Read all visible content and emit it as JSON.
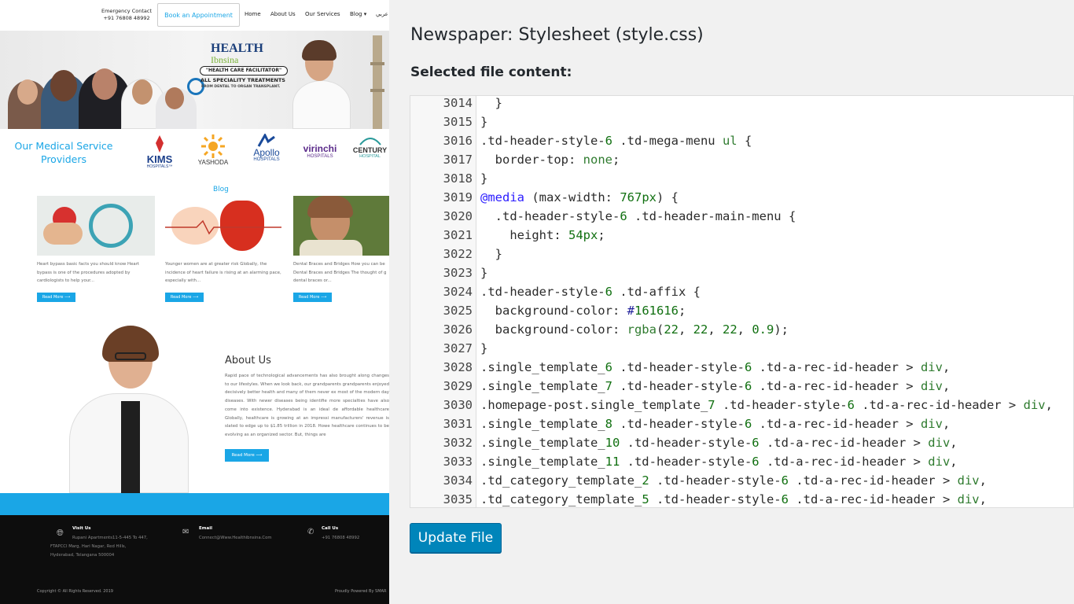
{
  "site": {
    "emergency_label": "Emergency Contact",
    "emergency_phone": "+91 76808 48992",
    "book_button": "Book an Appointment",
    "nav": {
      "home": "Home",
      "about": "About Us",
      "services": "Our Services",
      "blog": "Blog ▾",
      "arabic": "عربي"
    },
    "hero": {
      "brand_line1": "HEALTH",
      "brand_line2": "Ibnsina",
      "tagline": "\"HEALTH CARE FACILITATOR\"",
      "treatments": "ALL SPECIALITY TREATMENTS",
      "sub": "FROM DENTAL    TO ORGAN    TRANSPLANT."
    },
    "providers_title": "Our Medical Service Providers",
    "providers": [
      {
        "name": "KIMS",
        "sub": "HOSPITALS™",
        "color": "#1a3e8a"
      },
      {
        "name": "YASHODA",
        "sub": "",
        "color": "#333333"
      },
      {
        "name": "Apollo",
        "sub": "HOSPITALS",
        "color": "#1a4a9a"
      },
      {
        "name": "virinchi",
        "sub": "HOSPITALS",
        "color": "#5a2a8a"
      },
      {
        "name": "CENTURY",
        "sub": "HOSPITAL",
        "color": "#333333"
      }
    ],
    "blog_heading": "Blog",
    "blog_cards": [
      {
        "text": "Heart bypass basic facts you should know Heart bypass is one of the procedures adopted by cardiologists to help your...",
        "button": "Read More ⟶"
      },
      {
        "text": "Younger women are at greater risk Globally, the incidence of heart failure is rising at an alarming pace, especially with...",
        "button": "Read More ⟶"
      },
      {
        "text": "Dental Braces and Bridges How you can be Dental Braces and Bridges The thought of g dental braces or...",
        "button": "Read More ⟶"
      }
    ],
    "about": {
      "title": "About Us",
      "text": "Rapid pace of technological advancements has also brought along changes to our lifestyles. When we look back, our grandparents grandparents enjoyed decisively better health and many of them never ex most of the modern day diseases. With newer diseases being identifie more specialties have also come into existence. Hyderabad is an ideal de affordable healthcare Globally, healthcare is growing at an impressi manufacturers' revenue is slated to edge up to $1.85 trillion in 2018. Howe healthcare continues to be evolving as an organized sector. But, things are",
      "button": "Read More ⟶"
    },
    "footer": {
      "visit_title": "Visit Us",
      "visit_text_1": "Rupani Apartments11-5-445 To 447,",
      "visit_text_2": "FTAPCCI Marg, Hari Nagar, Red Hills,",
      "visit_text_3": "Hyderabad, Telangana 500004",
      "email_title": "Email",
      "email_text": "Connect@Www.Healthibnsina.Com",
      "call_title": "Call Us",
      "call_text": "+91 76808 48992",
      "copyright": "Copyright © All Rights Reserved. 2019",
      "powered": "Proudly Powered By SMAR"
    }
  },
  "editor": {
    "title": "Newspaper: Stylesheet (style.css)",
    "subtitle": "Selected file content:",
    "update_button": "Update File",
    "lines": [
      {
        "n": "3014",
        "code": "  }"
      },
      {
        "n": "3015",
        "code": "}"
      },
      {
        "n": "3016",
        "code": ".td-header-style-6 .td-mega-menu ul {"
      },
      {
        "n": "3017",
        "code": "  border-top: none;"
      },
      {
        "n": "3018",
        "code": "}"
      },
      {
        "n": "3019",
        "code": "@media (max-width: 767px) {"
      },
      {
        "n": "3020",
        "code": "  .td-header-style-6 .td-header-main-menu {"
      },
      {
        "n": "3021",
        "code": "    height: 54px;"
      },
      {
        "n": "3022",
        "code": "  }"
      },
      {
        "n": "3023",
        "code": "}"
      },
      {
        "n": "3024",
        "code": ".td-header-style-6 .td-affix {"
      },
      {
        "n": "3025",
        "code": "  background-color: #161616;"
      },
      {
        "n": "3026",
        "code": "  background-color: rgba(22, 22, 22, 0.9);"
      },
      {
        "n": "3027",
        "code": "}"
      },
      {
        "n": "3028",
        "code": ".single_template_6 .td-header-style-6 .td-a-rec-id-header > div,"
      },
      {
        "n": "3029",
        "code": ".single_template_7 .td-header-style-6 .td-a-rec-id-header > div,"
      },
      {
        "n": "3030",
        "code": ".homepage-post.single_template_7 .td-header-style-6 .td-a-rec-id-header > div,"
      },
      {
        "n": "3031",
        "code": ".single_template_8 .td-header-style-6 .td-a-rec-id-header > div,"
      },
      {
        "n": "3032",
        "code": ".single_template_10 .td-header-style-6 .td-a-rec-id-header > div,"
      },
      {
        "n": "3033",
        "code": ".single_template_11 .td-header-style-6 .td-a-rec-id-header > div,"
      },
      {
        "n": "3034",
        "code": ".td_category_template_2 .td-header-style-6 .td-a-rec-id-header > div,"
      },
      {
        "n": "3035",
        "code": ".td_category_template_5 .td-header-style-6 .td-a-rec-id-header > div,"
      }
    ]
  },
  "colors": {
    "accent": "#1aa6e6",
    "wp_button": "#0085ba",
    "footer_bg": "#0d0d0d"
  }
}
